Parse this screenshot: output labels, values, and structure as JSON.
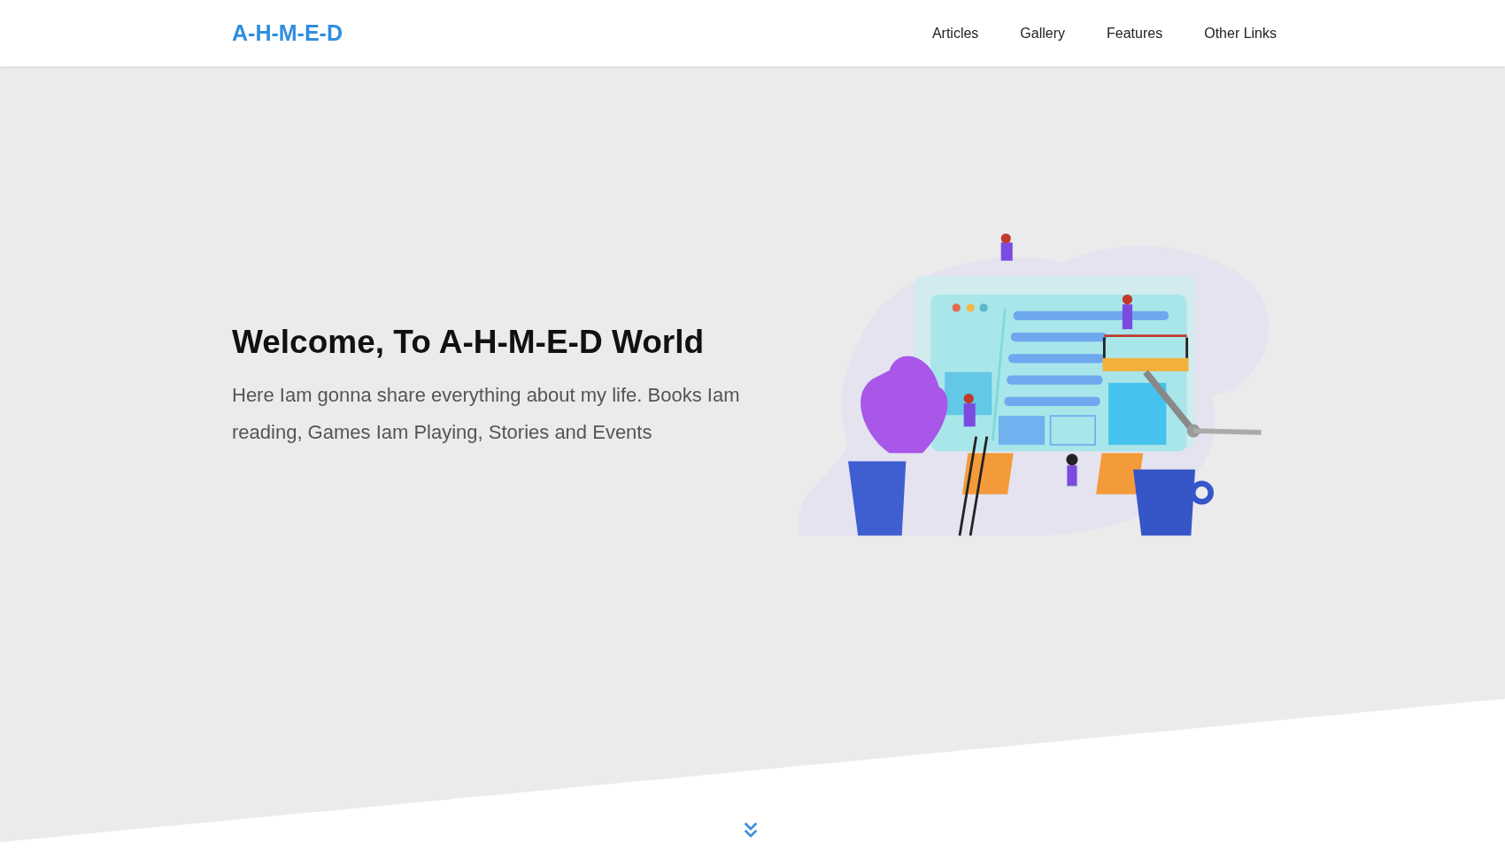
{
  "header": {
    "logo": "A-H-M-E-D",
    "nav": [
      "Articles",
      "Gallery",
      "Features",
      "Other Links"
    ]
  },
  "hero": {
    "title": "Welcome, To A-H-M-E-D World",
    "text": "Here Iam gonna share everything about my life. Books Iam reading, Games Iam Playing, Stories and Events"
  }
}
